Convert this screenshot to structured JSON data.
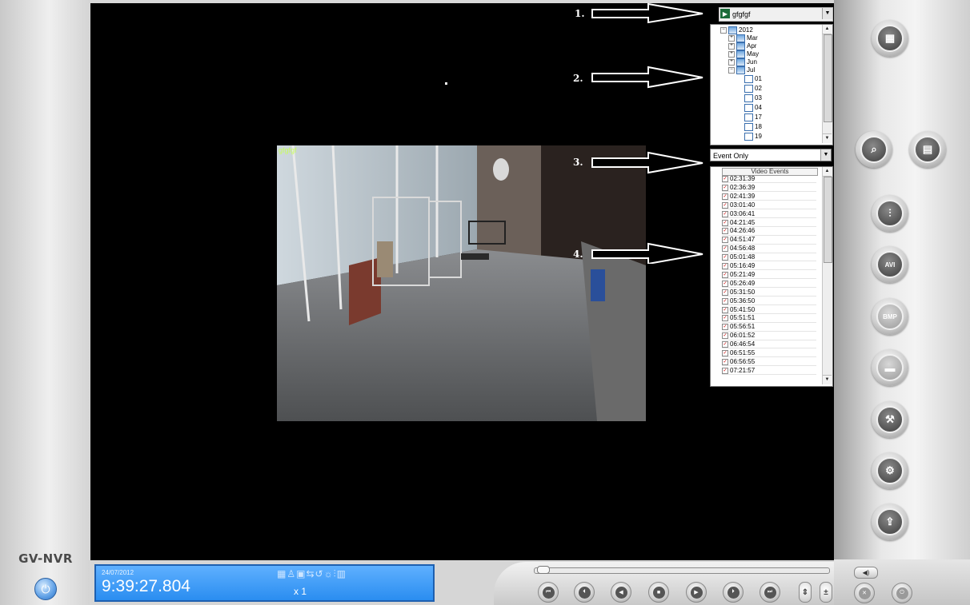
{
  "app": {
    "brand": "GV-NVR"
  },
  "camera": {
    "name": "gfgfgf",
    "overlay_label": "gfgfgf"
  },
  "date_tree": {
    "rows": [
      {
        "label": "2012",
        "kind": "year"
      },
      {
        "label": "Mar",
        "kind": "month"
      },
      {
        "label": "Apr",
        "kind": "month"
      },
      {
        "label": "May",
        "kind": "month"
      },
      {
        "label": "Jun",
        "kind": "month"
      },
      {
        "label": "Jul",
        "kind": "month"
      },
      {
        "label": "01",
        "kind": "day"
      },
      {
        "label": "02",
        "kind": "day"
      },
      {
        "label": "03",
        "kind": "day"
      },
      {
        "label": "04",
        "kind": "day"
      },
      {
        "label": "17",
        "kind": "day"
      },
      {
        "label": "18",
        "kind": "day"
      },
      {
        "label": "19",
        "kind": "day"
      }
    ]
  },
  "filter": {
    "selected": "Event Only"
  },
  "events": {
    "header": "Video Events",
    "items": [
      "02:31:39",
      "02:36:39",
      "02:41:39",
      "03:01:40",
      "03:06:41",
      "04:21:45",
      "04:26:46",
      "04:51:47",
      "04:56:48",
      "05:01:48",
      "05:16:49",
      "05:21:49",
      "05:26:49",
      "05:31:50",
      "05:36:50",
      "05:41:50",
      "05:51:51",
      "05:56:51",
      "06:01:52",
      "06:46:54",
      "06:51:55",
      "06:56:55",
      "07:21:57"
    ]
  },
  "annotations": [
    "1.",
    "2.",
    "3.",
    "4."
  ],
  "status": {
    "date": "24/07/2012",
    "time": "9:39:27.804",
    "speed": "x 1"
  },
  "right_buttons": [
    {
      "icon": "camera-grid-icon",
      "glyph": "▦"
    },
    {
      "icon": "search-icon",
      "glyph": "⌕"
    },
    {
      "icon": "document-icon",
      "glyph": "▤"
    },
    {
      "icon": "adjust-sliders-icon",
      "glyph": "⫶"
    },
    {
      "icon": "save-avi-icon",
      "glyph": "AVI"
    },
    {
      "icon": "save-bmp-icon",
      "glyph": "BMP"
    },
    {
      "icon": "print-icon",
      "glyph": "▬"
    },
    {
      "icon": "tools-icon",
      "glyph": "⚒"
    },
    {
      "icon": "settings-icon",
      "glyph": "⚙"
    },
    {
      "icon": "export-icon",
      "glyph": "⇪"
    }
  ],
  "playback": {
    "buttons": [
      {
        "name": "first-frame-icon",
        "glyph": "⏮"
      },
      {
        "name": "previous-frame-icon",
        "glyph": "⏴"
      },
      {
        "name": "rewind-icon",
        "glyph": "◀"
      },
      {
        "name": "stop-icon",
        "glyph": "■"
      },
      {
        "name": "play-icon",
        "glyph": "▶"
      },
      {
        "name": "next-frame-icon",
        "glyph": "⏵"
      },
      {
        "name": "last-frame-icon",
        "glyph": "⏭"
      }
    ],
    "speed_buttons": [
      {
        "name": "speed-step-icon",
        "glyph": "⇕"
      },
      {
        "name": "speed-plus-minus-icon",
        "glyph": "±"
      }
    ],
    "volume": "◀)",
    "extra_buttons": [
      {
        "name": "audio-mute-icon",
        "glyph": "✕"
      },
      {
        "name": "power-icon",
        "glyph": "⏻"
      }
    ]
  },
  "colors": {
    "accent": "#2a8df0",
    "video_bg": "#000000",
    "event_check": "#cc0000"
  }
}
